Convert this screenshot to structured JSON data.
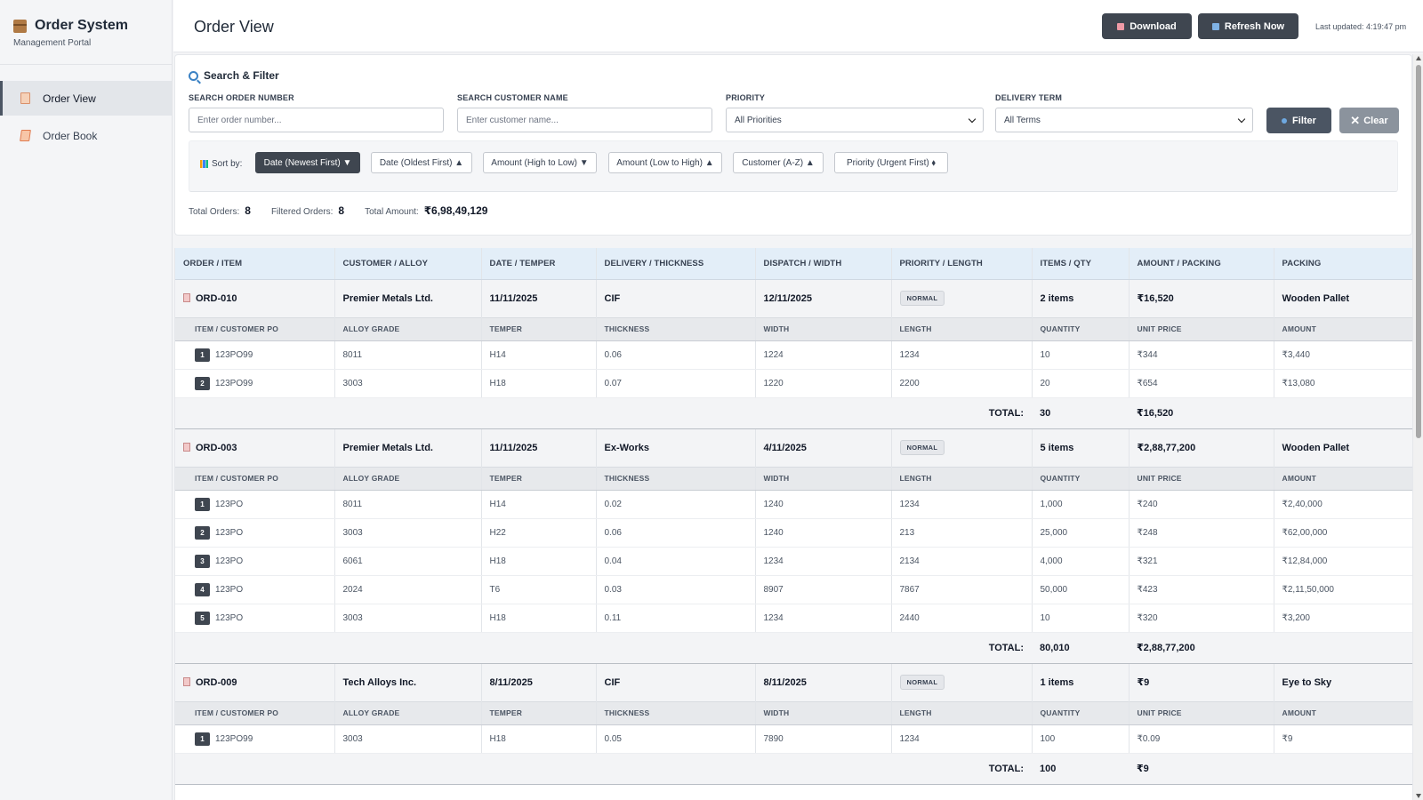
{
  "app": {
    "title": "Order System",
    "subtitle": "Management Portal"
  },
  "sidebar": {
    "items": [
      {
        "label": "Order View",
        "active": true
      },
      {
        "label": "Order Book",
        "active": false
      }
    ]
  },
  "header": {
    "title": "Order View",
    "download_label": "Download",
    "refresh_label": "Refresh Now",
    "last_updated": "Last updated: 4:19:47 pm"
  },
  "filter": {
    "title": "Search & Filter",
    "order_label": "SEARCH ORDER NUMBER",
    "order_placeholder": "Enter order number...",
    "customer_label": "SEARCH CUSTOMER NAME",
    "customer_placeholder": "Enter customer name...",
    "priority_label": "PRIORITY",
    "priority_value": "All Priorities",
    "delivery_label": "DELIVERY TERM",
    "delivery_value": "All Terms",
    "filter_label": "Filter",
    "clear_label": "Clear"
  },
  "sort": {
    "label": "Sort by:",
    "options": [
      {
        "label": "Date (Newest First) ▼"
      },
      {
        "label": "Date (Oldest First) ▲"
      },
      {
        "label": "Amount (High to Low) ▼"
      },
      {
        "label": "Amount (Low to High) ▲"
      },
      {
        "label": "Customer (A-Z) ▲"
      },
      {
        "label": "Priority (Urgent First) ⬧"
      }
    ]
  },
  "stats": {
    "total_label": "Total Orders:",
    "total": "8",
    "filtered_label": "Filtered Orders:",
    "filtered": "8",
    "amount_label": "Total Amount:",
    "amount": "₹6,98,49,129"
  },
  "table": {
    "columns": [
      "ORDER / ITEM",
      "CUSTOMER / ALLOY",
      "DATE / TEMPER",
      "DELIVERY / THICKNESS",
      "DISPATCH / WIDTH",
      "PRIORITY / LENGTH",
      "ITEMS / QTY",
      "AMOUNT / PACKING",
      "PACKING"
    ],
    "sub_columns": [
      "ITEM / CUSTOMER PO",
      "ALLOY GRADE",
      "TEMPER",
      "THICKNESS",
      "WIDTH",
      "LENGTH",
      "QUANTITY",
      "UNIT PRICE",
      "AMOUNT"
    ],
    "total_label": "TOTAL:",
    "orders": [
      {
        "id": "ORD-010",
        "customer": "Premier Metals Ltd.",
        "date": "11/11/2025",
        "delivery": "CIF",
        "dispatch": "12/11/2025",
        "priority": "NORMAL",
        "items": "2 items",
        "amount": "₹16,520",
        "packing": "Wooden Pallet",
        "rows": [
          {
            "n": "1",
            "po": "123PO99",
            "alloy": "8011",
            "temper": "H14",
            "thickness": "0.06",
            "width": "1224",
            "length": "1234",
            "qty": "10",
            "unit": "₹344",
            "amount": "₹3,440"
          },
          {
            "n": "2",
            "po": "123PO99",
            "alloy": "3003",
            "temper": "H18",
            "thickness": "0.07",
            "width": "1220",
            "length": "2200",
            "qty": "20",
            "unit": "₹654",
            "amount": "₹13,080"
          }
        ],
        "total_qty": "30",
        "total_amount": "₹16,520"
      },
      {
        "id": "ORD-003",
        "customer": "Premier Metals Ltd.",
        "date": "11/11/2025",
        "delivery": "Ex-Works",
        "dispatch": "4/11/2025",
        "priority": "NORMAL",
        "items": "5 items",
        "amount": "₹2,88,77,200",
        "packing": "Wooden Pallet",
        "rows": [
          {
            "n": "1",
            "po": "123PO",
            "alloy": "8011",
            "temper": "H14",
            "thickness": "0.02",
            "width": "1240",
            "length": "1234",
            "qty": "1,000",
            "unit": "₹240",
            "amount": "₹2,40,000"
          },
          {
            "n": "2",
            "po": "123PO",
            "alloy": "3003",
            "temper": "H22",
            "thickness": "0.06",
            "width": "1240",
            "length": "213",
            "qty": "25,000",
            "unit": "₹248",
            "amount": "₹62,00,000"
          },
          {
            "n": "3",
            "po": "123PO",
            "alloy": "6061",
            "temper": "H18",
            "thickness": "0.04",
            "width": "1234",
            "length": "2134",
            "qty": "4,000",
            "unit": "₹321",
            "amount": "₹12,84,000"
          },
          {
            "n": "4",
            "po": "123PO",
            "alloy": "2024",
            "temper": "T6",
            "thickness": "0.03",
            "width": "8907",
            "length": "7867",
            "qty": "50,000",
            "unit": "₹423",
            "amount": "₹2,11,50,000"
          },
          {
            "n": "5",
            "po": "123PO",
            "alloy": "3003",
            "temper": "H18",
            "thickness": "0.11",
            "width": "1234",
            "length": "2440",
            "qty": "10",
            "unit": "₹320",
            "amount": "₹3,200"
          }
        ],
        "total_qty": "80,010",
        "total_amount": "₹2,88,77,200"
      },
      {
        "id": "ORD-009",
        "customer": "Tech Alloys Inc.",
        "date": "8/11/2025",
        "delivery": "CIF",
        "dispatch": "8/11/2025",
        "priority": "NORMAL",
        "items": "1 items",
        "amount": "₹9",
        "packing": "Eye to Sky",
        "rows": [
          {
            "n": "1",
            "po": "123PO99",
            "alloy": "3003",
            "temper": "H18",
            "thickness": "0.05",
            "width": "7890",
            "length": "1234",
            "qty": "100",
            "unit": "₹0.09",
            "amount": "₹9"
          }
        ],
        "total_qty": "100",
        "total_amount": "₹9"
      }
    ]
  },
  "colors": {
    "primary_button": "#3f4650",
    "header_bg": "#e3eef8",
    "clear_button": "#8b939d"
  }
}
